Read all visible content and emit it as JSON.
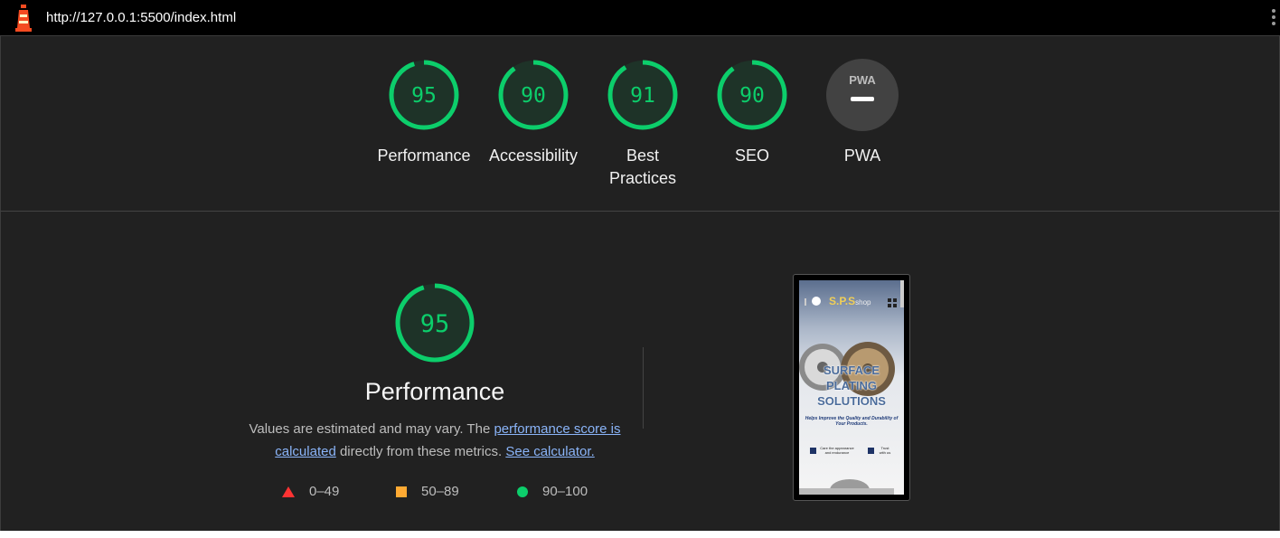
{
  "browser": {
    "url": "http://127.0.0.1:5500/index.html"
  },
  "scores": [
    {
      "label": "Performance",
      "value": "95",
      "fraction": 0.95
    },
    {
      "label": "Accessibility",
      "value": "90",
      "fraction": 0.9
    },
    {
      "label": "Best Practices",
      "value": "91",
      "fraction": 0.91
    },
    {
      "label": "SEO",
      "value": "90",
      "fraction": 0.9
    },
    {
      "label": "PWA",
      "value": "PWA"
    }
  ],
  "performance": {
    "score": "95",
    "fraction": 0.95,
    "title": "Performance",
    "desc_prefix": "Values are estimated and may vary. The ",
    "link1": "performance score is calculated",
    "desc_middle": " directly from these metrics. ",
    "link2": "See calculator."
  },
  "legend": [
    {
      "range": "0–49",
      "icon": "red-triangle-icon"
    },
    {
      "range": "50–89",
      "icon": "orange-square-icon"
    },
    {
      "range": "90–100",
      "icon": "green-circle-icon"
    }
  ],
  "screenshot": {
    "brand": "S.P.S",
    "brand_suffix": "shop",
    "headline": "SURFACE PLATING SOLUTIONS",
    "tagline": "Helps Improve the Quality and Durability of Your Products.",
    "check1": "Care the appearance and endurance",
    "check2": "Trust with us"
  },
  "colors": {
    "pass": "#0cce6b",
    "average": "#ffaa33",
    "fail": "#ff3333",
    "background": "#212121"
  }
}
